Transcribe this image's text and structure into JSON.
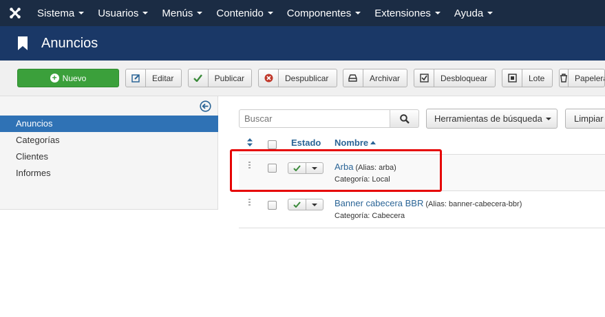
{
  "topnav": {
    "logo_icon": "joomla-logo-icon",
    "items": [
      "Sistema",
      "Usuarios",
      "Menús",
      "Contenido",
      "Componentes",
      "Extensiones",
      "Ayuda"
    ]
  },
  "title": "Anuncios",
  "toolbar": {
    "new_label": "Nuevo",
    "edit_label": "Editar",
    "publish_label": "Publicar",
    "unpublish_label": "Despublicar",
    "archive_label": "Archivar",
    "checkin_label": "Desbloquear",
    "batch_label": "Lote",
    "trash_label": "Papelera"
  },
  "sidebar": {
    "items": [
      "Anuncios",
      "Categorías",
      "Clientes",
      "Informes"
    ],
    "active": "Anuncios"
  },
  "search": {
    "placeholder": "Buscar",
    "tools_label": "Herramientas de búsqueda",
    "clear_label": "Limpiar"
  },
  "table": {
    "headers": {
      "status": "Estado",
      "name": "Nombre"
    },
    "rows": [
      {
        "name": "Arba",
        "alias": "(Alias: arba)",
        "category": "Categoría: Local"
      },
      {
        "name": "Banner cabecera BBR",
        "alias": "(Alias: banner-cabecera-bbr)",
        "category": "Categoría: Cabecera"
      }
    ]
  },
  "colors": {
    "nav_bg": "#1b2c44",
    "title_bg": "#1a3867",
    "new_button": "#3ba03b",
    "active_sidebar": "#2f72b5",
    "link": "#2a6496",
    "highlight_box": "#e60000"
  }
}
